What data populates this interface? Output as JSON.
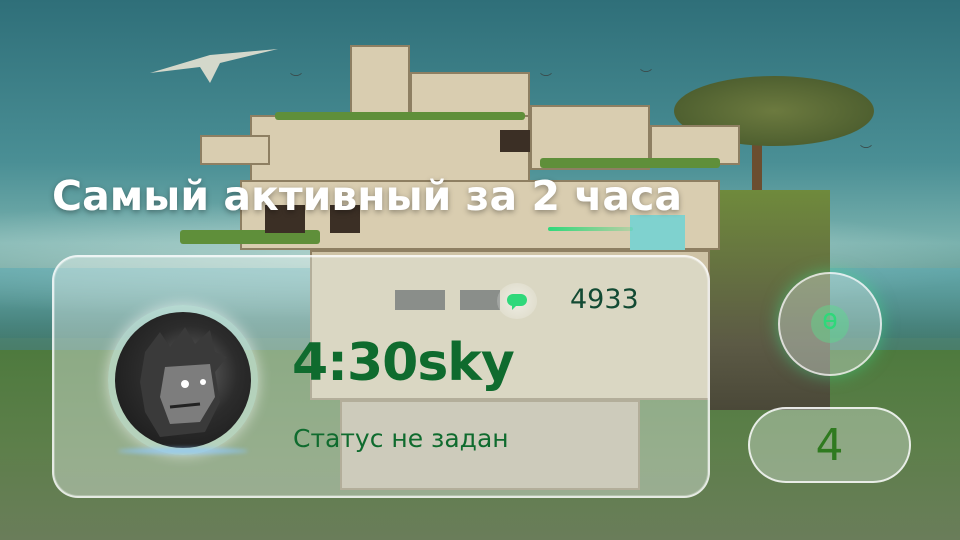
{
  "heading": "Самый активный за 2 часа",
  "player": {
    "nickname": "4:30sky",
    "status": "Статус не задан",
    "score": "4933",
    "rank": "4"
  },
  "icons": {
    "score": "message-icon",
    "side": "microphone-icon"
  },
  "colors": {
    "accent": "#2fd87a",
    "nickname": "#0f6b2e",
    "score": "#124a33",
    "rank": "#2f7a1f"
  }
}
